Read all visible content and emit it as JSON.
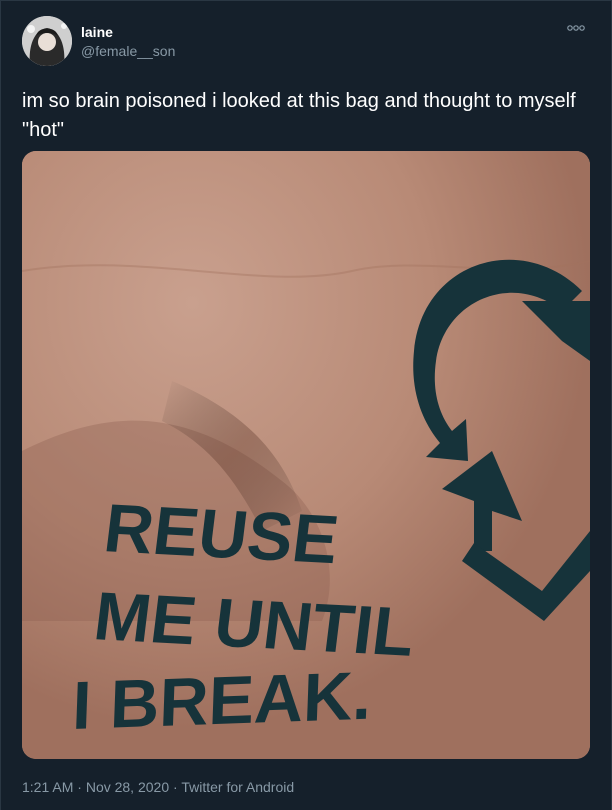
{
  "user": {
    "display_name": "laine",
    "handle": "@female__son"
  },
  "tweet": {
    "text": "im so brain poisoned i looked at this bag and thought to myself \"hot\""
  },
  "media": {
    "bag_text_line1": "REUSE",
    "bag_text_line2": "ME UNTIL",
    "bag_text_line3": "I BREAK.",
    "bag_color": "#b68672",
    "ink_color": "#16333a"
  },
  "footer": {
    "time": "1:21 AM",
    "separator": " · ",
    "date": "Nov 28, 2020",
    "source": "Twitter for Android"
  },
  "icons": {
    "more": "more-icon"
  }
}
